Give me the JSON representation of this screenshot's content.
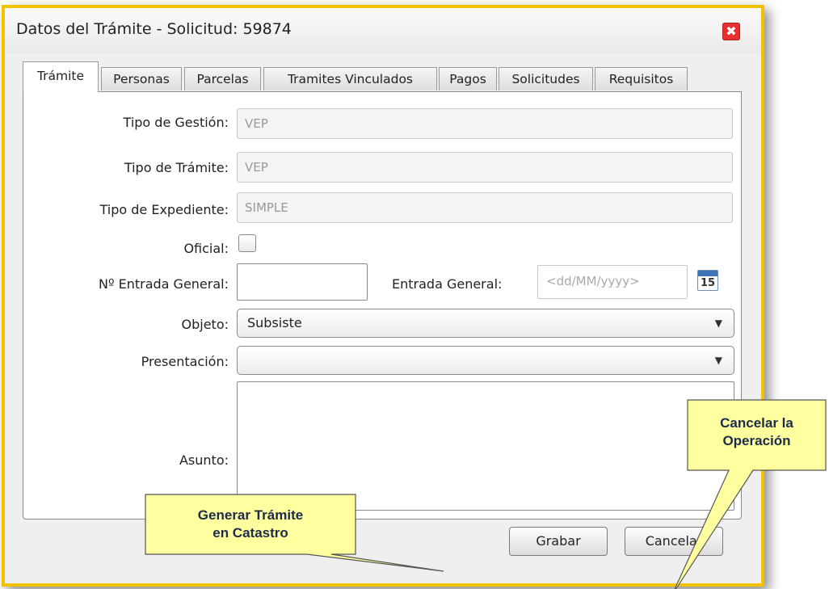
{
  "window": {
    "title": "Datos del Trámite - Solicitud: 59874",
    "close_icon": "✖"
  },
  "tabs": [
    {
      "label": "Trámite"
    },
    {
      "label": "Personas"
    },
    {
      "label": "Parcelas"
    },
    {
      "label": "Tramites Vinculados"
    },
    {
      "label": "Pagos"
    },
    {
      "label": "Solicitudes"
    },
    {
      "label": "Requisitos"
    }
  ],
  "form": {
    "tipo_gestion": {
      "label": "Tipo de Gestión:",
      "value": "VEP"
    },
    "tipo_tramite": {
      "label": "Tipo de Trámite:",
      "value": "VEP"
    },
    "tipo_expediente": {
      "label": "Tipo de Expediente:",
      "value": "SIMPLE"
    },
    "oficial": {
      "label": "Oficial:",
      "checked": false
    },
    "entrada_general_num": {
      "label": "Nº Entrada General:",
      "value": ""
    },
    "entrada_general_fecha": {
      "label": "Entrada General:",
      "placeholder": "<dd/MM/yyyy>",
      "calendar_day": "15"
    },
    "objeto": {
      "label": "Objeto:",
      "value": "Subsiste"
    },
    "presentacion": {
      "label": "Presentación:",
      "value": ""
    },
    "asunto": {
      "label": "Asunto:",
      "value": ""
    }
  },
  "buttons": {
    "save": "Grabar",
    "cancel": "Cancelar"
  },
  "callouts": {
    "generate": {
      "line1": "Generar Trámite",
      "line2": "en Catastro"
    },
    "cancel": {
      "line1": "Cancelar la",
      "line2": "Operación"
    }
  },
  "colors": {
    "dialog_border": "#f2c200",
    "callout_fill": "#ffffa0",
    "close_button": "#e63030"
  }
}
